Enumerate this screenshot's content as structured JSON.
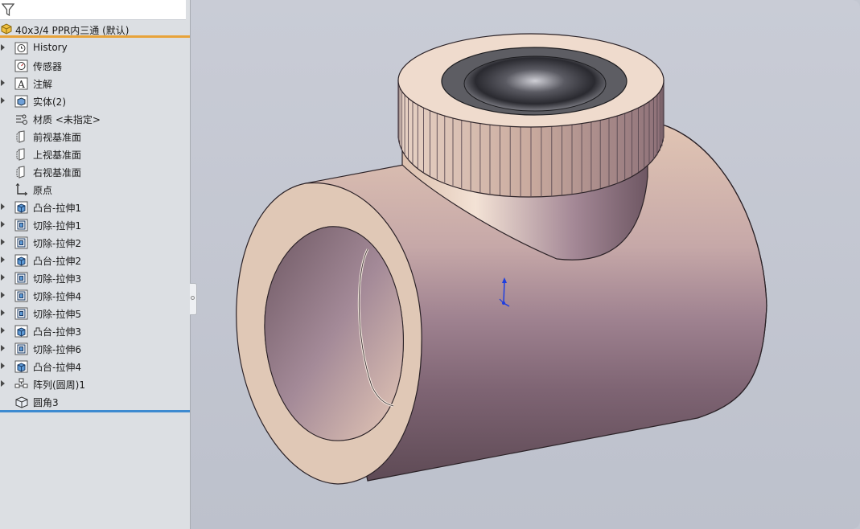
{
  "part": {
    "name": "40x3/4 PPR内三通 (默认)"
  },
  "feature_tree": [
    {
      "label": "History",
      "icon": "history-icon",
      "expandable": true
    },
    {
      "label": "传感器",
      "icon": "sensor-icon",
      "expandable": false
    },
    {
      "label": "注解",
      "icon": "annotation-icon",
      "expandable": true
    },
    {
      "label": "实体(2)",
      "icon": "solid-bodies-icon",
      "expandable": true
    },
    {
      "label": "材质 <未指定>",
      "icon": "material-icon",
      "expandable": false
    },
    {
      "label": "前视基准面",
      "icon": "plane-icon",
      "expandable": false
    },
    {
      "label": "上视基准面",
      "icon": "plane-icon",
      "expandable": false
    },
    {
      "label": "右视基准面",
      "icon": "plane-icon",
      "expandable": false
    },
    {
      "label": "原点",
      "icon": "origin-icon",
      "expandable": false
    },
    {
      "label": "凸台-拉伸1",
      "icon": "boss-extrude-icon",
      "expandable": true
    },
    {
      "label": "切除-拉伸1",
      "icon": "cut-extrude-icon",
      "expandable": true
    },
    {
      "label": "切除-拉伸2",
      "icon": "cut-extrude-icon",
      "expandable": true
    },
    {
      "label": "凸台-拉伸2",
      "icon": "boss-extrude-icon",
      "expandable": true
    },
    {
      "label": "切除-拉伸3",
      "icon": "cut-extrude-icon",
      "expandable": true
    },
    {
      "label": "切除-拉伸4",
      "icon": "cut-extrude-icon",
      "expandable": true
    },
    {
      "label": "切除-拉伸5",
      "icon": "cut-extrude-icon",
      "expandable": true
    },
    {
      "label": "凸台-拉伸3",
      "icon": "boss-extrude-icon",
      "expandable": true
    },
    {
      "label": "切除-拉伸6",
      "icon": "cut-extrude-icon",
      "expandable": true
    },
    {
      "label": "凸台-拉伸4",
      "icon": "boss-extrude-icon",
      "expandable": true
    },
    {
      "label": "阵列(圆周)1",
      "icon": "circular-pattern-icon",
      "expandable": true
    },
    {
      "label": "圆角3",
      "icon": "fillet-icon",
      "expandable": false
    }
  ],
  "colors": {
    "panel_bg": "#dcdfe3",
    "root_underline": "#e8a33a",
    "tree_end_line": "#3d8ad0",
    "viewport_bg": "#c3c7d1",
    "part_base": "#e3c9b7",
    "part_shadow": "#8a6f7d",
    "triad_blue": "#1e3fe0"
  }
}
